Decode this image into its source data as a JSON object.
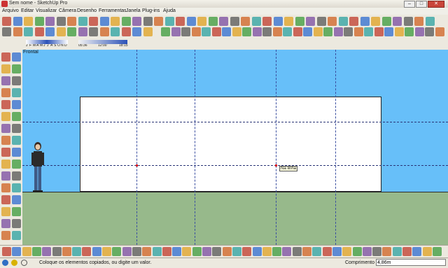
{
  "window": {
    "title": "Sem nome - SketchUp Pro"
  },
  "window_buttons": {
    "minimize": "–",
    "maximize": "□",
    "close": "✕"
  },
  "menu": [
    "Arquivo",
    "Editar",
    "Visualizar",
    "Câmera",
    "Desenho",
    "Ferramentas",
    "Janela",
    "Plug-ins",
    "Ajuda"
  ],
  "shadow_settings": {
    "months": [
      "J",
      "F",
      "M",
      "A",
      "M",
      "J",
      "J",
      "A",
      "S",
      "O",
      "N",
      "D"
    ],
    "times": [
      "05:36",
      "12:00",
      "18:15"
    ]
  },
  "viewport": {
    "view_label": "Frontal",
    "tooltip": "Na linha",
    "sky_color": "#67bff9",
    "ground_color": "#97b98b"
  },
  "status": {
    "hint": "Coloque os elementos copiados, ou digite um valor.",
    "measurement_label": "Comprimento",
    "measurement_value": "4,86m"
  },
  "toolbar_icons": [
    "select-icon",
    "eraser-icon",
    "pencil-icon",
    "line-icon",
    "arc-icon",
    "rectangle-icon",
    "circle-icon",
    "polygon-icon",
    "push-pull-icon",
    "offset-icon",
    "move-icon",
    "rotate-icon",
    "scale-icon",
    "follow-me-icon",
    "tape-measure-icon",
    "text-icon",
    "protractor-icon",
    "axes-icon",
    "dimension-icon",
    "orbit-icon",
    "pan-icon",
    "zoom-icon",
    "zoom-extents-icon",
    "walk-icon",
    "look-around-icon",
    "section-plane-icon",
    "paint-bucket-icon",
    "component-icon",
    "undo-icon",
    "redo-icon",
    "cut-icon",
    "copy-icon",
    "paste-icon",
    "print-icon",
    "save-icon",
    "open-icon",
    "new-icon",
    "shadow-icon",
    "fog-icon",
    "xray-icon",
    "wireframe-icon",
    "shaded-icon",
    "textured-icon",
    "monochrome-icon",
    "iso-view-icon",
    "top-view-icon",
    "front-view-icon",
    "right-view-icon",
    "back-view-icon",
    "left-view-icon",
    "warehouse-icon",
    "sandbox-icon",
    "layer-icon"
  ]
}
